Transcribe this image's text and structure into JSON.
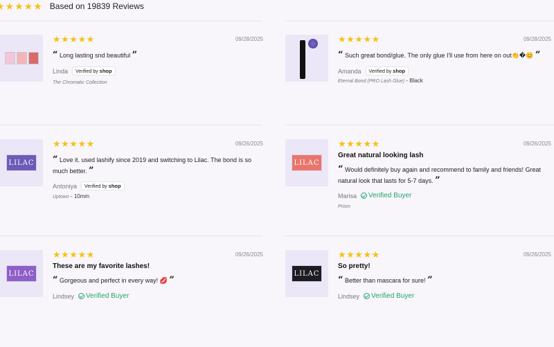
{
  "summary": {
    "stars": "★★★★★",
    "text": "Based on 19839 Reviews"
  },
  "reviews": [
    {
      "stars": "★★★★★",
      "date": "09/28/2025",
      "title": "",
      "body": "Long lasting snd beautiful",
      "author": "Linda",
      "verified": "shop",
      "product": "The Chromatic Collection",
      "variant": "",
      "thumb": "multi-color-boxes"
    },
    {
      "stars": "★★★★★",
      "date": "09/28/2025",
      "title": "",
      "body": "Such great bond/glue. The only glue I'll use from here on out👏�😊",
      "author": "Amanda",
      "verified": "shop",
      "product": "Eternal Bond (PRO Lash Glue)",
      "variant": " - Black",
      "thumb": "glue-tube"
    },
    {
      "stars": "★★★★★",
      "date": "09/26/2025",
      "title": "",
      "body": "Love it. used lashify since 2019 and switching to Lilac. The bond is so much better.",
      "author": "Antoniya",
      "verified": "shop",
      "product": "Uptown",
      "variant": " - 10mm",
      "thumb": "lilac-purple"
    },
    {
      "stars": "★★★★★",
      "date": "09/26/2025",
      "title": "Great natural looking lash",
      "body": "Would definitely buy again and recommend to family and friends! Great natural look that lasts for 5-7 days.",
      "author": "Marisa",
      "verified": "buyer",
      "product": "Prism",
      "variant": "",
      "thumb": "lilac-coral"
    },
    {
      "stars": "★★★★★",
      "date": "09/26/2025",
      "title": "These are my favorite lashes!",
      "body": "Gorgeous and perfect in every way! 💋",
      "author": "Lindsey",
      "verified": "buyer",
      "product": "",
      "variant": "",
      "thumb": "lilac-violet"
    },
    {
      "stars": "★★★★★",
      "date": "09/26/2025",
      "title": "So pretty!",
      "body": "Better than mascara for sure!",
      "author": "Lindsey",
      "verified": "buyer",
      "product": "",
      "variant": "",
      "thumb": "lilac-black"
    }
  ],
  "labels": {
    "verified_by": "Verified by",
    "shop": "shop",
    "verified_buyer": "Verified Buyer",
    "open_quote": "“",
    "close_quote": "”"
  },
  "colors": {
    "star": "#f3c215",
    "verified": "#23a36c",
    "thumb_bg": "#ece7f6"
  }
}
